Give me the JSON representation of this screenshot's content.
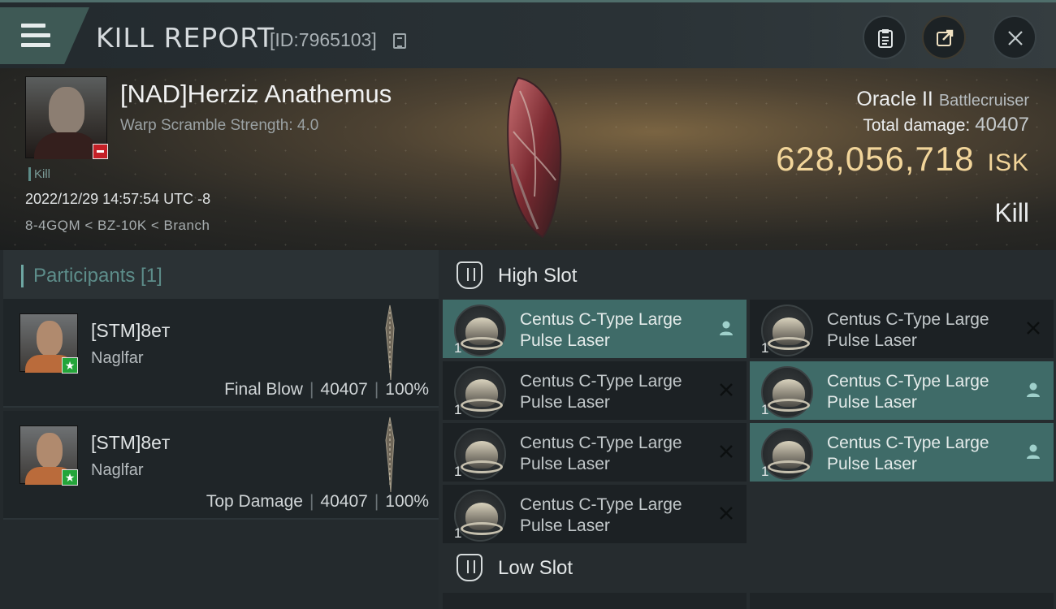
{
  "header": {
    "title": "KILL REPORT",
    "report_id": "[ID:7965103]"
  },
  "victim": {
    "name": "[NAD]Herziz Anathemus",
    "warp_scramble": "Warp Scramble Strength: 4.0",
    "tag": "Kill",
    "datetime": "2022/12/29 14:57:54 UTC -8",
    "location": "8-4GQM < BZ-10K < Branch"
  },
  "ship": {
    "name": "Oracle II",
    "class": "Battlecruiser",
    "total_damage_label": "Total damage:",
    "total_damage_value": "40407",
    "isk_value": "628,056,718",
    "isk_unit": "ISK",
    "result": "Kill"
  },
  "participants": {
    "header": "Participants [1]",
    "items": [
      {
        "name": "[STM]8eт",
        "ship": "Naglfar",
        "role": "Final Blow",
        "damage": "40407",
        "percent": "100%"
      },
      {
        "name": "[STM]8eт",
        "ship": "Naglfar",
        "role": "Top Damage",
        "damage": "40407",
        "percent": "100%"
      }
    ]
  },
  "slots": {
    "high": {
      "label": "High Slot",
      "modules": [
        {
          "line1": "Centus C-Type Large",
          "line2": "Pulse Laser",
          "qty": "1",
          "status": "person"
        },
        {
          "line1": "Centus C-Type Large",
          "line2": "Pulse Laser",
          "qty": "1",
          "status": "close"
        },
        {
          "line1": "Centus C-Type Large",
          "line2": "Pulse Laser",
          "qty": "1",
          "status": "close"
        },
        {
          "line1": "Centus C-Type Large",
          "line2": "Pulse Laser",
          "qty": "1",
          "status": "person"
        },
        {
          "line1": "Centus C-Type Large",
          "line2": "Pulse Laser",
          "qty": "1",
          "status": "close"
        },
        {
          "line1": "Centus C-Type Large",
          "line2": "Pulse Laser",
          "qty": "1",
          "status": "person"
        },
        {
          "line1": "Centus C-Type Large",
          "line2": "Pulse Laser",
          "qty": "1",
          "status": "close"
        }
      ]
    },
    "low": {
      "label": "Low Slot"
    }
  },
  "colors": {
    "accent_teal": "#3f6b68",
    "isk_gold": "#f2d59a",
    "danger_red": "#c42027",
    "ally_green": "#24a53a"
  }
}
